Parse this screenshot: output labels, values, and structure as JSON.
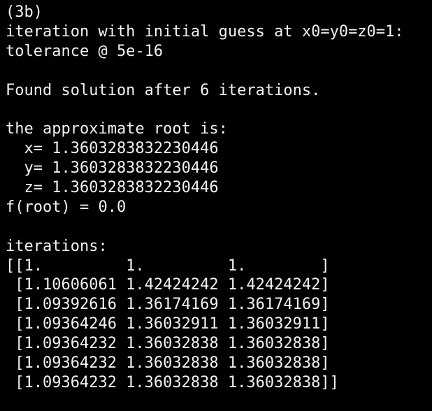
{
  "colors": {
    "background": "#000000",
    "foreground": "#f2f2f2"
  },
  "terminal": {
    "lines": [
      "(3b)",
      "iteration with initial guess at x0=y0=z0=1:",
      "tolerance @ 5e-16",
      "",
      "Found solution after 6 iterations.",
      "",
      "the approximate root is:",
      "  x= 1.3603283832230446",
      "  y= 1.3603283832230446",
      "  z= 1.3603283832230446",
      "f(root) = 0.0",
      "",
      "iterations:",
      "[[1.         1.         1.        ]",
      " [1.10606061 1.42424242 1.42424242]",
      " [1.09392616 1.36174169 1.36174169]",
      " [1.09364246 1.36032911 1.36032911]",
      " [1.09364232 1.36032838 1.36032838]",
      " [1.09364232 1.36032838 1.36032838]",
      " [1.09364232 1.36032838 1.36032838]]"
    ]
  }
}
